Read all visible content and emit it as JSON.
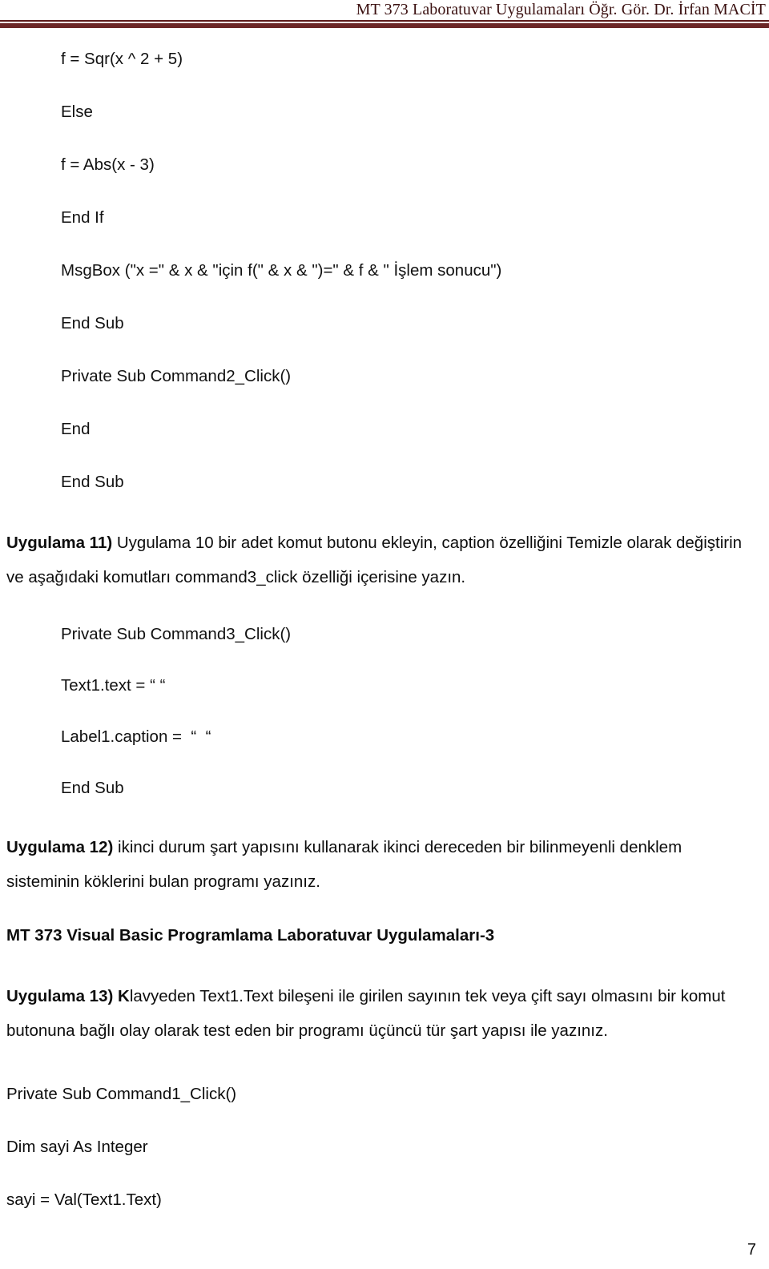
{
  "header": {
    "title": "MT 373 Laboratuvar Uygulamaları Öğr. Gör. Dr. İrfan MACİT",
    "rule_color_thin": "#5d1c1c",
    "rule_color_thick": "#6b2525"
  },
  "body": {
    "code_block_1": [
      "f = Sqr(x ^ 2 + 5)",
      "Else",
      "f = Abs(x - 3)",
      "End If",
      "MsgBox (\"x =\" & x & \"için f(\" & x & \")=\" & f & \" İşlem sonucu\")",
      "End Sub",
      "Private Sub Command2_Click()",
      "End",
      "End Sub"
    ],
    "uygulama11": {
      "label": "Uygulama 11)",
      "text": " Uygulama 10 bir adet komut butonu ekleyin, caption özelliğini Temizle olarak değiştirin ve aşağıdaki komutları command3_click özelliği içerisine yazın."
    },
    "code_block_2": [
      "Private Sub Command3_Click()",
      "Text1.text = “ “",
      "Label1.caption =  “  “",
      "End Sub"
    ],
    "uygulama12": {
      "label": "Uygulama 12)",
      "text": " ikinci durum şart yapısını kullanarak ikinci dereceden bir bilinmeyenli denklem sisteminin köklerini bulan programı yazınız."
    },
    "section_heading": "MT 373 Visual Basic Programlama Laboratuvar Uygulamaları-3",
    "uygulama13": {
      "label": "Uygulama 13) K",
      "text": "lavyeden Text1.Text bileşeni ile girilen sayının tek veya çift sayı olmasını bir komut butonuna bağlı olay olarak test eden bir programı üçüncü tür şart yapısı ile yazınız."
    },
    "code_block_3": [
      "Private Sub Command1_Click()",
      "Dim sayi As Integer",
      "sayi = Val(Text1.Text)"
    ]
  },
  "footer": {
    "page_number": "7"
  }
}
